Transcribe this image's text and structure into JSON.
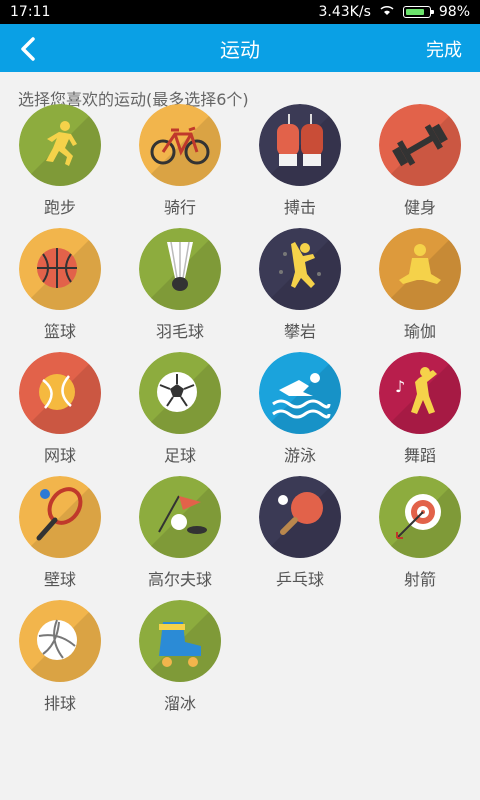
{
  "status": {
    "time": "17:11",
    "net_speed": "3.43K/s",
    "battery": "98%"
  },
  "header": {
    "title": "运动",
    "done_label": "完成"
  },
  "hint": "选择您喜欢的运动(最多选择6个)",
  "sports": [
    {
      "label": "跑步",
      "icon": "running-icon",
      "color": "#8dac3e"
    },
    {
      "label": "骑行",
      "icon": "bicycle-icon",
      "color": "#f2b54c"
    },
    {
      "label": "搏击",
      "icon": "boxing-gloves-icon",
      "color": "#3b3a55"
    },
    {
      "label": "健身",
      "icon": "dumbbell-icon",
      "color": "#e2624a"
    },
    {
      "label": "篮球",
      "icon": "basketball-icon",
      "color": "#f2b54c"
    },
    {
      "label": "羽毛球",
      "icon": "shuttlecock-icon",
      "color": "#8dac3e"
    },
    {
      "label": "攀岩",
      "icon": "climbing-icon",
      "color": "#3b3a55"
    },
    {
      "label": "瑜伽",
      "icon": "yoga-icon",
      "color": "#dd9a3c"
    },
    {
      "label": "网球",
      "icon": "tennis-ball-icon",
      "color": "#e2624a"
    },
    {
      "label": "足球",
      "icon": "soccer-ball-icon",
      "color": "#8dac3e"
    },
    {
      "label": "游泳",
      "icon": "swimming-icon",
      "color": "#1ba3dc"
    },
    {
      "label": "舞蹈",
      "icon": "dance-icon",
      "color": "#b81e4c"
    },
    {
      "label": "壁球",
      "icon": "squash-racket-icon",
      "color": "#f2b54c"
    },
    {
      "label": "高尔夫球",
      "icon": "golf-icon",
      "color": "#8dac3e"
    },
    {
      "label": "乒乓球",
      "icon": "ping-pong-icon",
      "color": "#3b3a55"
    },
    {
      "label": "射箭",
      "icon": "archery-icon",
      "color": "#8dac3e"
    },
    {
      "label": "排球",
      "icon": "volleyball-icon",
      "color": "#f2b54c"
    },
    {
      "label": "溜冰",
      "icon": "roller-skate-icon",
      "color": "#8dac3e"
    }
  ]
}
